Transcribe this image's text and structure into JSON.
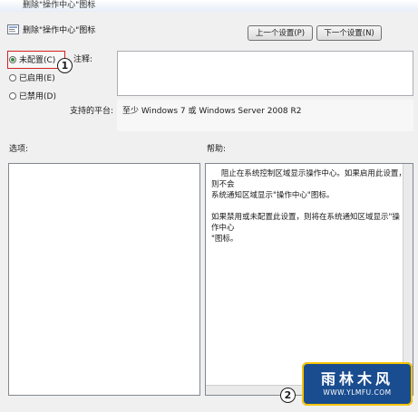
{
  "window": {
    "title": "删除\"操作中心\"图标"
  },
  "header": {
    "title": "删除\"操作中心\"图标"
  },
  "buttons": {
    "prev_label": "上一个设置(P)",
    "next_label": "下一个设置(N)"
  },
  "radios": [
    {
      "label": "未配置(C)",
      "checked": true
    },
    {
      "label": "已启用(E)",
      "checked": false
    },
    {
      "label": "已禁用(D)",
      "checked": false
    }
  ],
  "comment": {
    "label": "注释:",
    "value": ""
  },
  "platform": {
    "label": "支持的平台:",
    "value": "至少 Windows 7 或 Windows Server 2008 R2"
  },
  "options": {
    "label": "选项:"
  },
  "help": {
    "label": "帮助:",
    "text": "    阻止在系统控制区域显示操作中心。如果启用此设置，则不会\n系统通知区域显示\"操作中心\"图标。\n\n如果禁用或未配置此设置，则将在系统通知区域显示\"操作中心\n\"图标。"
  },
  "callouts": {
    "one": "1",
    "two": "2"
  },
  "watermark": {
    "brand": "雨林木风",
    "url": "WWW.YLMFU.COM"
  },
  "colors": {
    "highlight": "#d42020",
    "window_bg": "#f0f0f0"
  }
}
